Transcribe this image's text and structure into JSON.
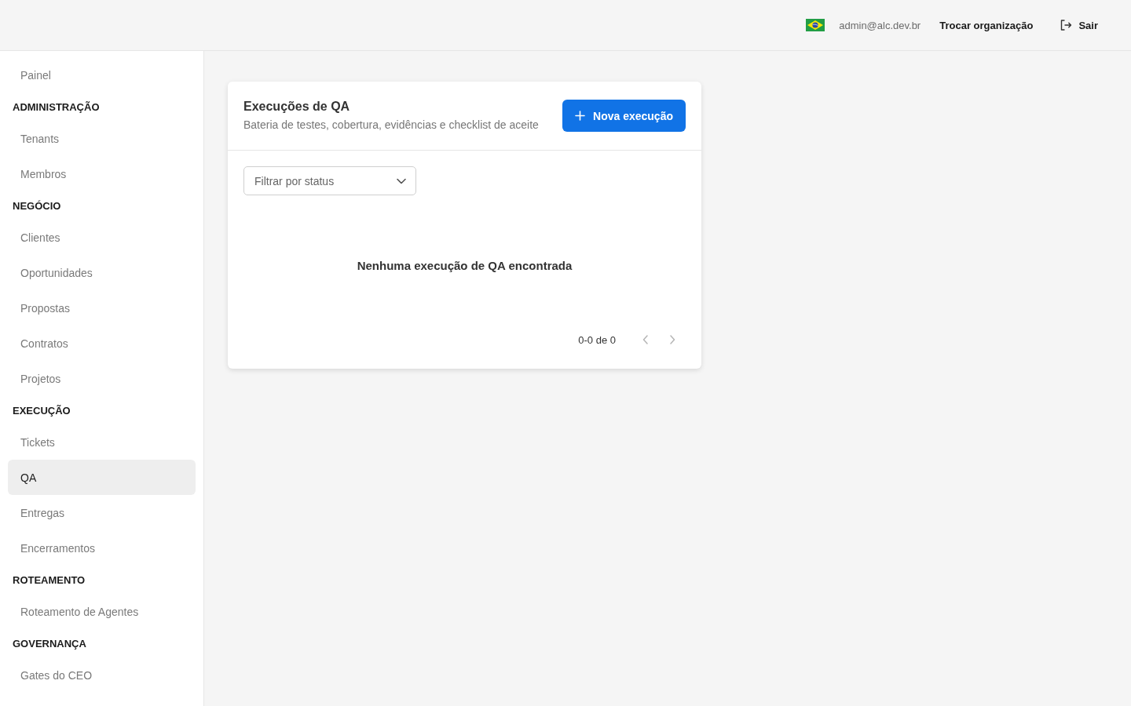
{
  "header": {
    "email": "admin@alc.dev.br",
    "actions": [
      {
        "label": "Trocar organização",
        "kind": "text"
      },
      {
        "label": "Sair",
        "kind": "logout"
      }
    ]
  },
  "sidebar": {
    "sections": [
      {
        "items": [
          {
            "label": "Painel",
            "selected": false
          }
        ]
      },
      {
        "title": "ADMINISTRAÇÃO",
        "items": [
          {
            "label": "Tenants",
            "selected": false
          },
          {
            "label": "Membros",
            "selected": false
          }
        ]
      },
      {
        "title": "NEGÓCIO",
        "items": [
          {
            "label": "Clientes",
            "selected": false
          },
          {
            "label": "Oportunidades",
            "selected": false
          },
          {
            "label": "Propostas",
            "selected": false
          },
          {
            "label": "Contratos",
            "selected": false
          },
          {
            "label": "Projetos",
            "selected": false
          }
        ]
      },
      {
        "title": "EXECUÇÃO",
        "items": [
          {
            "label": "Tickets",
            "selected": false
          },
          {
            "label": "QA",
            "selected": true
          },
          {
            "label": "Entregas",
            "selected": false
          },
          {
            "label": "Encerramentos",
            "selected": false
          }
        ]
      },
      {
        "title": "ROTEAMENTO",
        "items": [
          {
            "label": "Roteamento de Agentes",
            "selected": false
          }
        ]
      },
      {
        "title": "GOVERNANÇA",
        "items": [
          {
            "label": "Gates do CEO",
            "selected": false
          }
        ]
      }
    ]
  },
  "panel": {
    "title": "Execuções de QA",
    "subtitle": "Bateria de testes, cobertura, evidências e checklist de aceite",
    "primary_button": "Nova execução",
    "filter": {
      "placeholder": "Filtrar por status"
    },
    "empty_message": "Nenhuma execução de QA encontrada",
    "pagination": {
      "range": "0-0 de 0",
      "prev_disabled": true,
      "next_disabled": true
    }
  }
}
